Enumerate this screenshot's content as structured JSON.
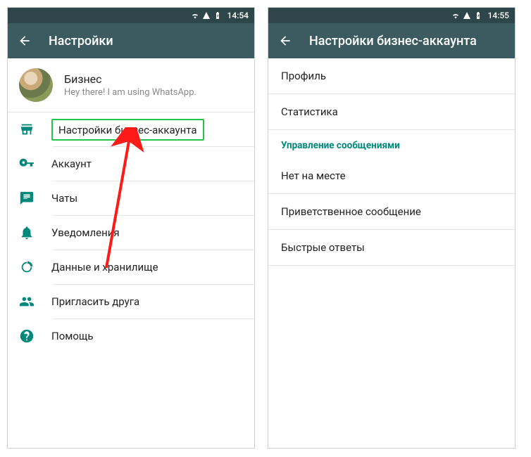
{
  "left": {
    "statusbar": {
      "time": "14:54"
    },
    "appbar": {
      "title": "Настройки"
    },
    "profile": {
      "name": "Бизнес",
      "status": "Hey there! I am using WhatsApp."
    },
    "items": [
      {
        "icon": "store",
        "label": "Настройки бизнес-аккаунта",
        "highlighted": true
      },
      {
        "icon": "key",
        "label": "Аккаунт"
      },
      {
        "icon": "chat",
        "label": "Чаты"
      },
      {
        "icon": "bell",
        "label": "Уведомления"
      },
      {
        "icon": "data",
        "label": "Данные и хранилище"
      },
      {
        "icon": "invite",
        "label": "Пригласить друга"
      },
      {
        "icon": "help",
        "label": "Помощь"
      }
    ]
  },
  "right": {
    "statusbar": {
      "time": "14:55"
    },
    "appbar": {
      "title": "Настройки бизнес-аккаунта"
    },
    "items": [
      {
        "label": "Профиль"
      },
      {
        "label": "Статистика"
      }
    ],
    "section_header": "Управление сообщениями",
    "section_items": [
      {
        "label": "Нет на месте"
      },
      {
        "label": "Приветственное сообщение"
      },
      {
        "label": "Быстрые ответы"
      }
    ]
  },
  "colors": {
    "accent": "#00897b",
    "appbar": "#3b5b60",
    "statusbar": "#2e4549",
    "highlight": "#27c24c",
    "arrow": "#ff1a1a"
  }
}
